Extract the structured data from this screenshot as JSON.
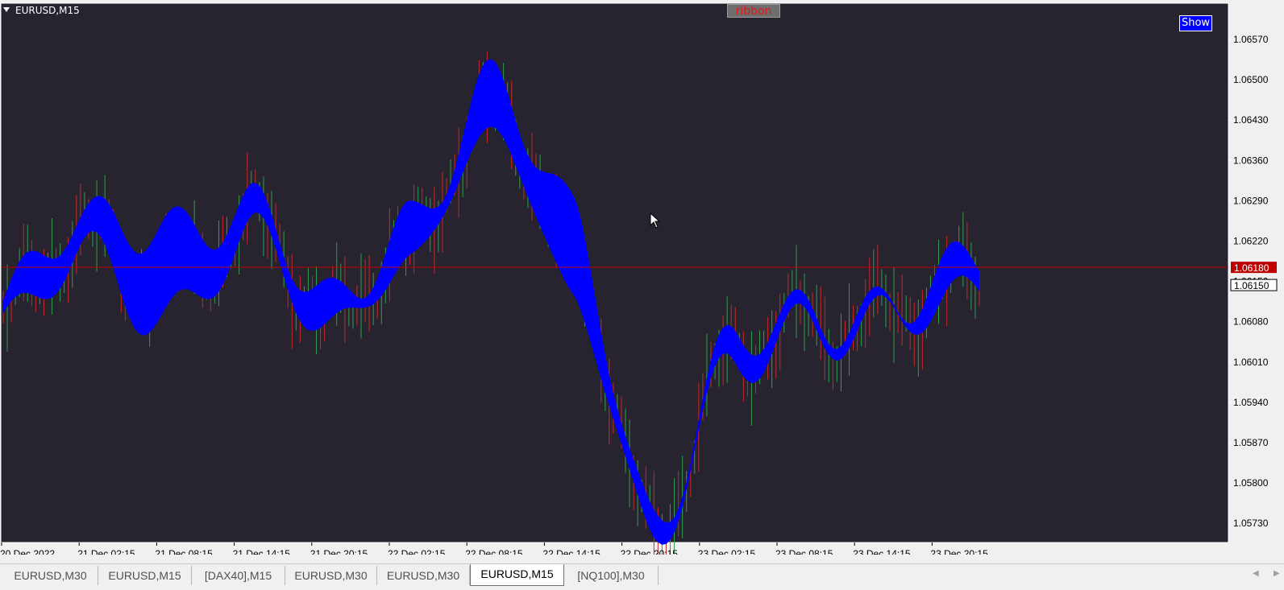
{
  "window": {
    "symbol_label": "EURUSD,M15"
  },
  "buttons": {
    "ribbon": "ribbon",
    "show": "Show"
  },
  "colors": {
    "background": "#27232f",
    "bull_ribbon": "#0000ff",
    "bear_ribbon": "#ff0000",
    "bull_candle": "#2f9e4f",
    "bear_candle": "#c42a2a",
    "price_line": "#c00000",
    "axis_text": "#ffffff"
  },
  "price_axis": {
    "labels": [
      "1.06570",
      "1.06500",
      "1.06430",
      "1.06360",
      "1.06290",
      "1.06220",
      "1.06150",
      "1.06080",
      "1.06010",
      "1.05940",
      "1.05870",
      "1.05800",
      "1.05730"
    ],
    "current_price_marker": "1.06180",
    "bid_marker": "1.06150"
  },
  "time_axis": {
    "labels": [
      "20 Dec 2022",
      "21 Dec 02:15",
      "21 Dec 08:15",
      "21 Dec 14:15",
      "21 Dec 20:15",
      "22 Dec 02:15",
      "22 Dec 08:15",
      "22 Dec 14:15",
      "22 Dec 20:15",
      "23 Dec 02:15",
      "23 Dec 08:15",
      "23 Dec 14:15",
      "23 Dec 20:15"
    ]
  },
  "chart_data": {
    "type": "line",
    "title": "EURUSD,M15",
    "ylim": [
      1.057,
      1.0662
    ],
    "x": [
      "20 Dec 2022",
      "21 Dec 02:15",
      "21 Dec 08:15",
      "21 Dec 14:15",
      "21 Dec 20:15",
      "22 Dec 02:15",
      "22 Dec 08:15",
      "22 Dec 14:15",
      "22 Dec 20:15",
      "23 Dec 02:15",
      "23 Dec 08:15",
      "23 Dec 14:15",
      "23 Dec 20:15"
    ],
    "series": [
      {
        "values": [
          1.0612,
          1.0624,
          1.0627,
          1.0627,
          1.061,
          1.0628,
          1.0648,
          1.0626,
          1.0576,
          1.0603,
          1.0609,
          1.0614,
          1.0617
        ]
      },
      {
        "values": [
          1.0608,
          1.0619,
          1.061,
          1.0623,
          1.0606,
          1.0621,
          1.0641,
          1.0613,
          1.0573,
          1.06,
          1.0607,
          1.0611,
          1.0612
        ]
      }
    ],
    "last_price": 1.0618
  },
  "tabs": [
    {
      "label": "EURUSD,M30",
      "active": false
    },
    {
      "label": "EURUSD,M15",
      "active": false
    },
    {
      "label": "[DAX40],M15",
      "active": false
    },
    {
      "label": "EURUSD,M30",
      "active": false
    },
    {
      "label": "EURUSD,M30",
      "active": false
    },
    {
      "label": "EURUSD,M15",
      "active": true
    },
    {
      "label": "[NQ100],M30",
      "active": false
    }
  ],
  "tab_scroll": {
    "left": "◀",
    "right": "▶"
  }
}
